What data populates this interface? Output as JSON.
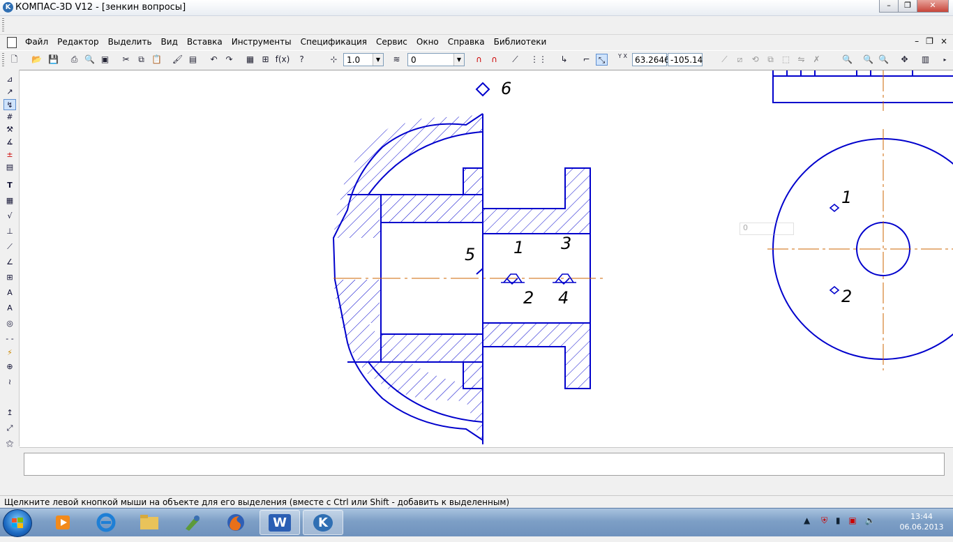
{
  "window": {
    "app_logo": "K",
    "title": "КОМПАС-3D V12 - [зенкин вопросы]",
    "minimize_glyph": "–",
    "maximize_glyph": "❐",
    "close_glyph": "✕"
  },
  "menu": {
    "items": [
      "Файл",
      "Редактор",
      "Выделить",
      "Вид",
      "Вставка",
      "Инструменты",
      "Спецификация",
      "Сервис",
      "Окно",
      "Справка",
      "Библиотеки"
    ],
    "mdi_minimize": "–",
    "mdi_restore": "❐",
    "mdi_close": "×"
  },
  "toolbar": {
    "scale_value": "1.0",
    "layer_value": "0",
    "coord_x": "63.2646",
    "coord_y": "-105.14",
    "fx_label": "f(x)",
    "xy_label": "Y X"
  },
  "drawing": {
    "line_color": "#0000cc",
    "axis_color": "#cc6600",
    "labels": {
      "l6": "6",
      "l5": "5",
      "l1": "1",
      "l3": "3",
      "l2": "2",
      "l4": "4",
      "r1": "1",
      "r2": "2"
    }
  },
  "ghost_panel": {
    "value": "0"
  },
  "statusbar": {
    "text": "Щелкните левой кнопкой мыши на объекте для его выделения (вместе с Ctrl или Shift - добавить к выделенным)"
  },
  "taskbar": {
    "word_label": "W",
    "kompas_label": "K",
    "time": "13:44",
    "date": "06.06.2013"
  }
}
